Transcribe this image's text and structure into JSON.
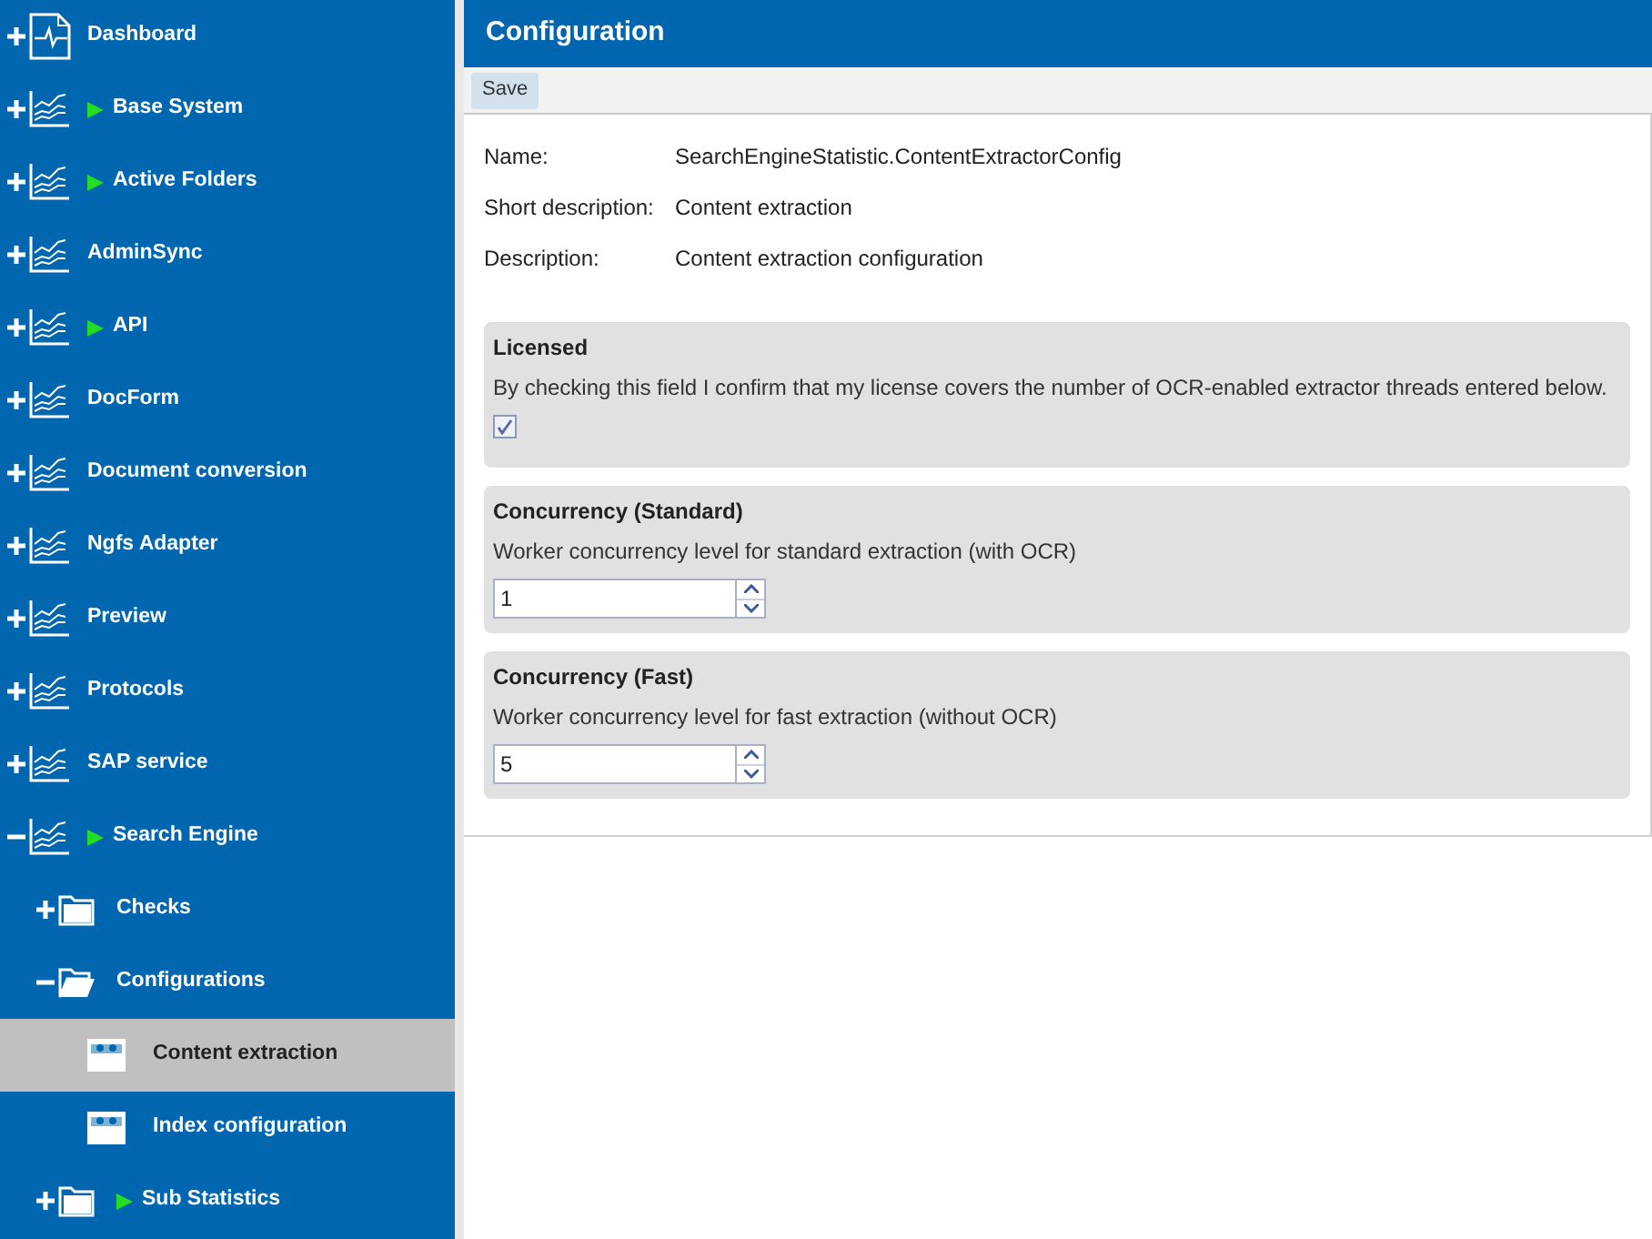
{
  "sidebar": {
    "items": [
      {
        "label": "Dashboard",
        "kind": "dashboard",
        "expanded": false,
        "running": false
      },
      {
        "label": "Base System",
        "kind": "chart",
        "expanded": false,
        "running": true
      },
      {
        "label": "Active Folders",
        "kind": "chart",
        "expanded": false,
        "running": true
      },
      {
        "label": "AdminSync",
        "kind": "chart",
        "expanded": false,
        "running": false
      },
      {
        "label": "API",
        "kind": "chart",
        "expanded": false,
        "running": true
      },
      {
        "label": "DocForm",
        "kind": "chart",
        "expanded": false,
        "running": false
      },
      {
        "label": "Document conversion",
        "kind": "chart",
        "expanded": false,
        "running": false
      },
      {
        "label": "Ngfs Adapter",
        "kind": "chart",
        "expanded": false,
        "running": false
      },
      {
        "label": "Preview",
        "kind": "chart",
        "expanded": false,
        "running": false
      },
      {
        "label": "Protocols",
        "kind": "chart",
        "expanded": false,
        "running": false
      },
      {
        "label": "SAP service",
        "kind": "chart",
        "expanded": false,
        "running": false
      },
      {
        "label": "Search Engine",
        "kind": "chart",
        "expanded": true,
        "running": true,
        "children": [
          {
            "label": "Checks",
            "kind": "folder",
            "expanded": false,
            "running": false
          },
          {
            "label": "Configurations",
            "kind": "folder",
            "expanded": true,
            "running": false,
            "children": [
              {
                "label": "Content extraction",
                "kind": "config",
                "running": false,
                "selected": true
              },
              {
                "label": "Index configuration",
                "kind": "config",
                "running": false,
                "selected": false
              }
            ]
          },
          {
            "label": "Sub Statistics",
            "kind": "folder",
            "expanded": false,
            "running": true
          }
        ]
      }
    ]
  },
  "panel": {
    "title": "Configuration",
    "toolbar": {
      "buttons": [
        "Save"
      ]
    },
    "properties": [
      {
        "label": "Name:",
        "value": "SearchEngineStatistic.ContentExtractorConfig"
      },
      {
        "label": "Short description:",
        "value": "Content extraction"
      },
      {
        "label": "Description:",
        "value": "Content extraction configuration"
      }
    ],
    "fields": [
      {
        "kind": "checkbox",
        "title": "Licensed",
        "description": "By checking this field I confirm that my license covers the number of OCR-enabled extractor threads entered below.",
        "checked": true
      },
      {
        "kind": "spinner",
        "title": "Concurrency (Standard)",
        "description": "Worker concurrency level for standard extraction (with OCR)",
        "value": "1"
      },
      {
        "kind": "spinner",
        "title": "Concurrency (Fast)",
        "description": "Worker concurrency level for fast extraction (without OCR)",
        "value": "5"
      }
    ]
  }
}
